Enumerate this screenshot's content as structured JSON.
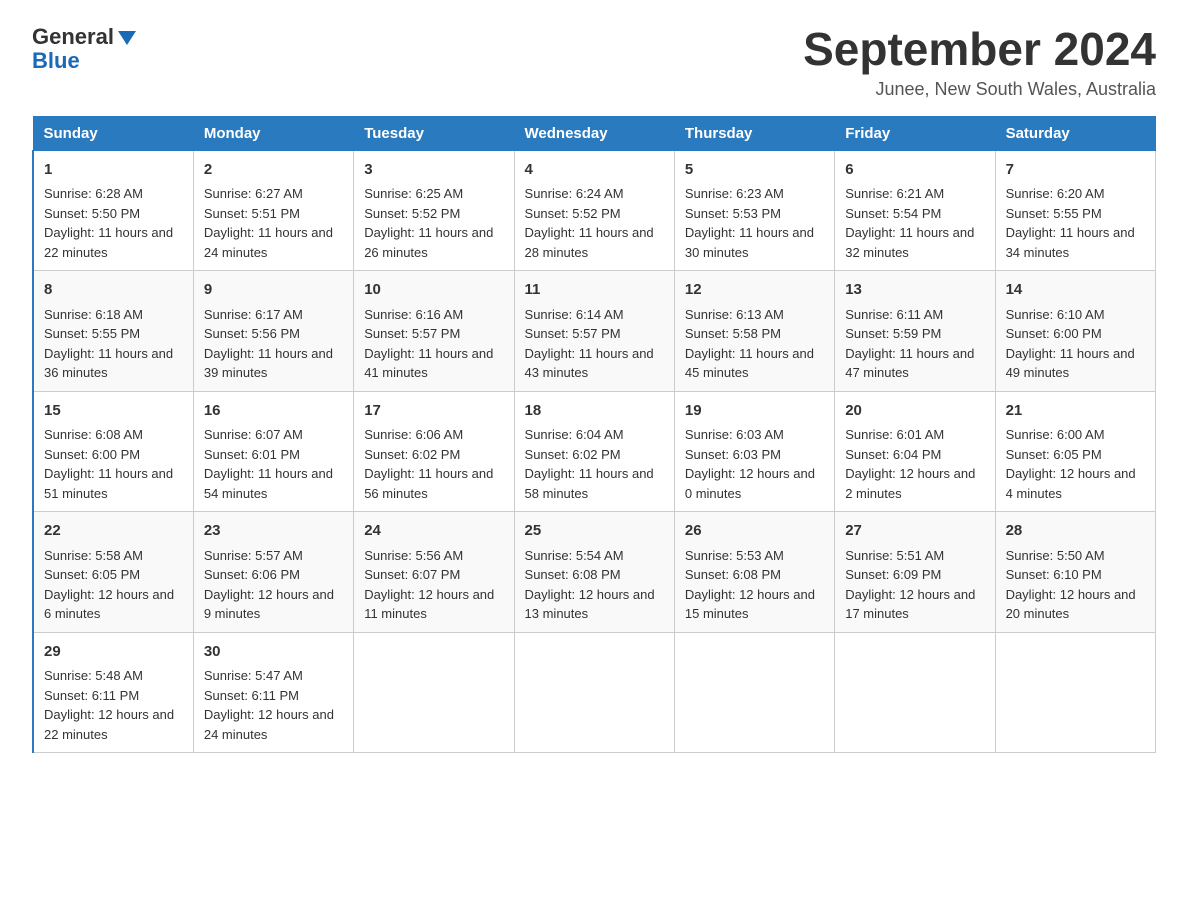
{
  "header": {
    "logo_general": "General",
    "logo_blue": "Blue",
    "month_title": "September 2024",
    "location": "Junee, New South Wales, Australia"
  },
  "days_of_week": [
    "Sunday",
    "Monday",
    "Tuesday",
    "Wednesday",
    "Thursday",
    "Friday",
    "Saturday"
  ],
  "weeks": [
    [
      {
        "day": "1",
        "sunrise": "6:28 AM",
        "sunset": "5:50 PM",
        "daylight": "11 hours and 22 minutes."
      },
      {
        "day": "2",
        "sunrise": "6:27 AM",
        "sunset": "5:51 PM",
        "daylight": "11 hours and 24 minutes."
      },
      {
        "day": "3",
        "sunrise": "6:25 AM",
        "sunset": "5:52 PM",
        "daylight": "11 hours and 26 minutes."
      },
      {
        "day": "4",
        "sunrise": "6:24 AM",
        "sunset": "5:52 PM",
        "daylight": "11 hours and 28 minutes."
      },
      {
        "day": "5",
        "sunrise": "6:23 AM",
        "sunset": "5:53 PM",
        "daylight": "11 hours and 30 minutes."
      },
      {
        "day": "6",
        "sunrise": "6:21 AM",
        "sunset": "5:54 PM",
        "daylight": "11 hours and 32 minutes."
      },
      {
        "day": "7",
        "sunrise": "6:20 AM",
        "sunset": "5:55 PM",
        "daylight": "11 hours and 34 minutes."
      }
    ],
    [
      {
        "day": "8",
        "sunrise": "6:18 AM",
        "sunset": "5:55 PM",
        "daylight": "11 hours and 36 minutes."
      },
      {
        "day": "9",
        "sunrise": "6:17 AM",
        "sunset": "5:56 PM",
        "daylight": "11 hours and 39 minutes."
      },
      {
        "day": "10",
        "sunrise": "6:16 AM",
        "sunset": "5:57 PM",
        "daylight": "11 hours and 41 minutes."
      },
      {
        "day": "11",
        "sunrise": "6:14 AM",
        "sunset": "5:57 PM",
        "daylight": "11 hours and 43 minutes."
      },
      {
        "day": "12",
        "sunrise": "6:13 AM",
        "sunset": "5:58 PM",
        "daylight": "11 hours and 45 minutes."
      },
      {
        "day": "13",
        "sunrise": "6:11 AM",
        "sunset": "5:59 PM",
        "daylight": "11 hours and 47 minutes."
      },
      {
        "day": "14",
        "sunrise": "6:10 AM",
        "sunset": "6:00 PM",
        "daylight": "11 hours and 49 minutes."
      }
    ],
    [
      {
        "day": "15",
        "sunrise": "6:08 AM",
        "sunset": "6:00 PM",
        "daylight": "11 hours and 51 minutes."
      },
      {
        "day": "16",
        "sunrise": "6:07 AM",
        "sunset": "6:01 PM",
        "daylight": "11 hours and 54 minutes."
      },
      {
        "day": "17",
        "sunrise": "6:06 AM",
        "sunset": "6:02 PM",
        "daylight": "11 hours and 56 minutes."
      },
      {
        "day": "18",
        "sunrise": "6:04 AM",
        "sunset": "6:02 PM",
        "daylight": "11 hours and 58 minutes."
      },
      {
        "day": "19",
        "sunrise": "6:03 AM",
        "sunset": "6:03 PM",
        "daylight": "12 hours and 0 minutes."
      },
      {
        "day": "20",
        "sunrise": "6:01 AM",
        "sunset": "6:04 PM",
        "daylight": "12 hours and 2 minutes."
      },
      {
        "day": "21",
        "sunrise": "6:00 AM",
        "sunset": "6:05 PM",
        "daylight": "12 hours and 4 minutes."
      }
    ],
    [
      {
        "day": "22",
        "sunrise": "5:58 AM",
        "sunset": "6:05 PM",
        "daylight": "12 hours and 6 minutes."
      },
      {
        "day": "23",
        "sunrise": "5:57 AM",
        "sunset": "6:06 PM",
        "daylight": "12 hours and 9 minutes."
      },
      {
        "day": "24",
        "sunrise": "5:56 AM",
        "sunset": "6:07 PM",
        "daylight": "12 hours and 11 minutes."
      },
      {
        "day": "25",
        "sunrise": "5:54 AM",
        "sunset": "6:08 PM",
        "daylight": "12 hours and 13 minutes."
      },
      {
        "day": "26",
        "sunrise": "5:53 AM",
        "sunset": "6:08 PM",
        "daylight": "12 hours and 15 minutes."
      },
      {
        "day": "27",
        "sunrise": "5:51 AM",
        "sunset": "6:09 PM",
        "daylight": "12 hours and 17 minutes."
      },
      {
        "day": "28",
        "sunrise": "5:50 AM",
        "sunset": "6:10 PM",
        "daylight": "12 hours and 20 minutes."
      }
    ],
    [
      {
        "day": "29",
        "sunrise": "5:48 AM",
        "sunset": "6:11 PM",
        "daylight": "12 hours and 22 minutes."
      },
      {
        "day": "30",
        "sunrise": "5:47 AM",
        "sunset": "6:11 PM",
        "daylight": "12 hours and 24 minutes."
      },
      null,
      null,
      null,
      null,
      null
    ]
  ],
  "labels": {
    "sunrise": "Sunrise:",
    "sunset": "Sunset:",
    "daylight": "Daylight:"
  }
}
